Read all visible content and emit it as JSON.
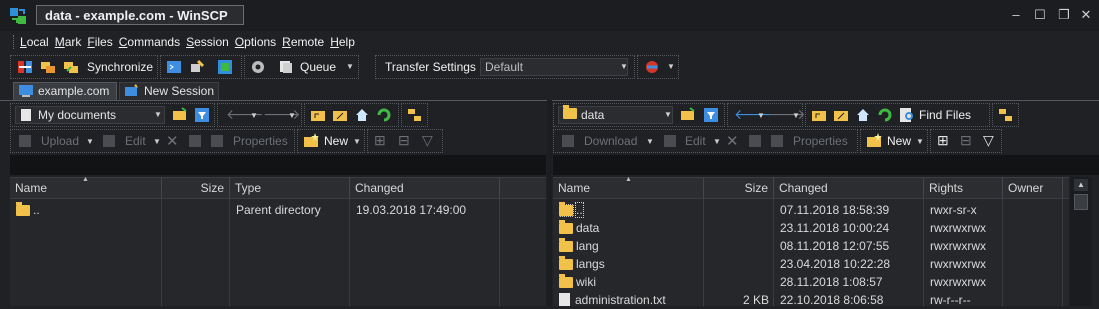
{
  "window": {
    "title": "data - example.com - WinSCP",
    "minimize": "–",
    "maximize": "☐",
    "close": "✕"
  },
  "menu": [
    {
      "label": "Local",
      "ul": "L",
      "rest": "ocal"
    },
    {
      "label": "Mark",
      "ul": "M",
      "rest": "ark"
    },
    {
      "label": "Files",
      "ul": "F",
      "rest": "iles"
    },
    {
      "label": "Commands",
      "ul": "C",
      "rest": "ommands"
    },
    {
      "label": "Session",
      "ul": "S",
      "rest": "ession"
    },
    {
      "label": "Options",
      "ul": "O",
      "rest": "ptions"
    },
    {
      "label": "Remote",
      "ul": "R",
      "rest": "emote"
    },
    {
      "label": "Help",
      "ul": "H",
      "rest": "elp"
    }
  ],
  "toolbar": {
    "synchronize": "Synchronize",
    "queue": "Queue",
    "transfer_settings_label": "Transfer Settings",
    "transfer_settings_value": "Default"
  },
  "tabs": {
    "active": "example.com",
    "new_session": "New Session"
  },
  "local": {
    "location": "My documents",
    "upload": "Upload",
    "edit": "Edit",
    "properties": "Properties",
    "new": "New",
    "columns": [
      "Name",
      "Size",
      "Type",
      "Changed"
    ],
    "rows": [
      {
        "name": "..",
        "size": "",
        "type": "Parent directory",
        "changed": "19.03.2018  17:49:00"
      }
    ]
  },
  "remote": {
    "location": "data",
    "find_files": "Find Files",
    "download": "Download",
    "edit": "Edit",
    "properties": "Properties",
    "new": "New",
    "columns": [
      "Name",
      "Size",
      "Changed",
      "Rights",
      "Owner"
    ],
    "rows": [
      {
        "name": "..",
        "size": "",
        "changed": "07.11.2018 18:58:39",
        "rights": "rwxr-sr-x",
        "owner": "",
        "kind": "parent"
      },
      {
        "name": "data",
        "size": "",
        "changed": "23.11.2018 10:00:24",
        "rights": "rwxrwxrwx",
        "owner": "",
        "kind": "folder"
      },
      {
        "name": "lang",
        "size": "",
        "changed": "08.11.2018 12:07:55",
        "rights": "rwxrwxrwx",
        "owner": "",
        "kind": "folder"
      },
      {
        "name": "langs",
        "size": "",
        "changed": "23.04.2018 10:22:28",
        "rights": "rwxrwxrwx",
        "owner": "",
        "kind": "folder"
      },
      {
        "name": "wiki",
        "size": "",
        "changed": "28.11.2018 1:08:57",
        "rights": "rwxrwxrwx",
        "owner": "",
        "kind": "folder"
      },
      {
        "name": "administration.txt",
        "size": "2 KB",
        "changed": "22.10.2018 8:06:58",
        "rights": "rw-r--r--",
        "owner": "",
        "kind": "file"
      }
    ]
  },
  "colors": {
    "accent_blue": "#3d8ee0",
    "folder_yellow": "#f2c14a",
    "green": "#41b842",
    "red": "#d8352a"
  }
}
